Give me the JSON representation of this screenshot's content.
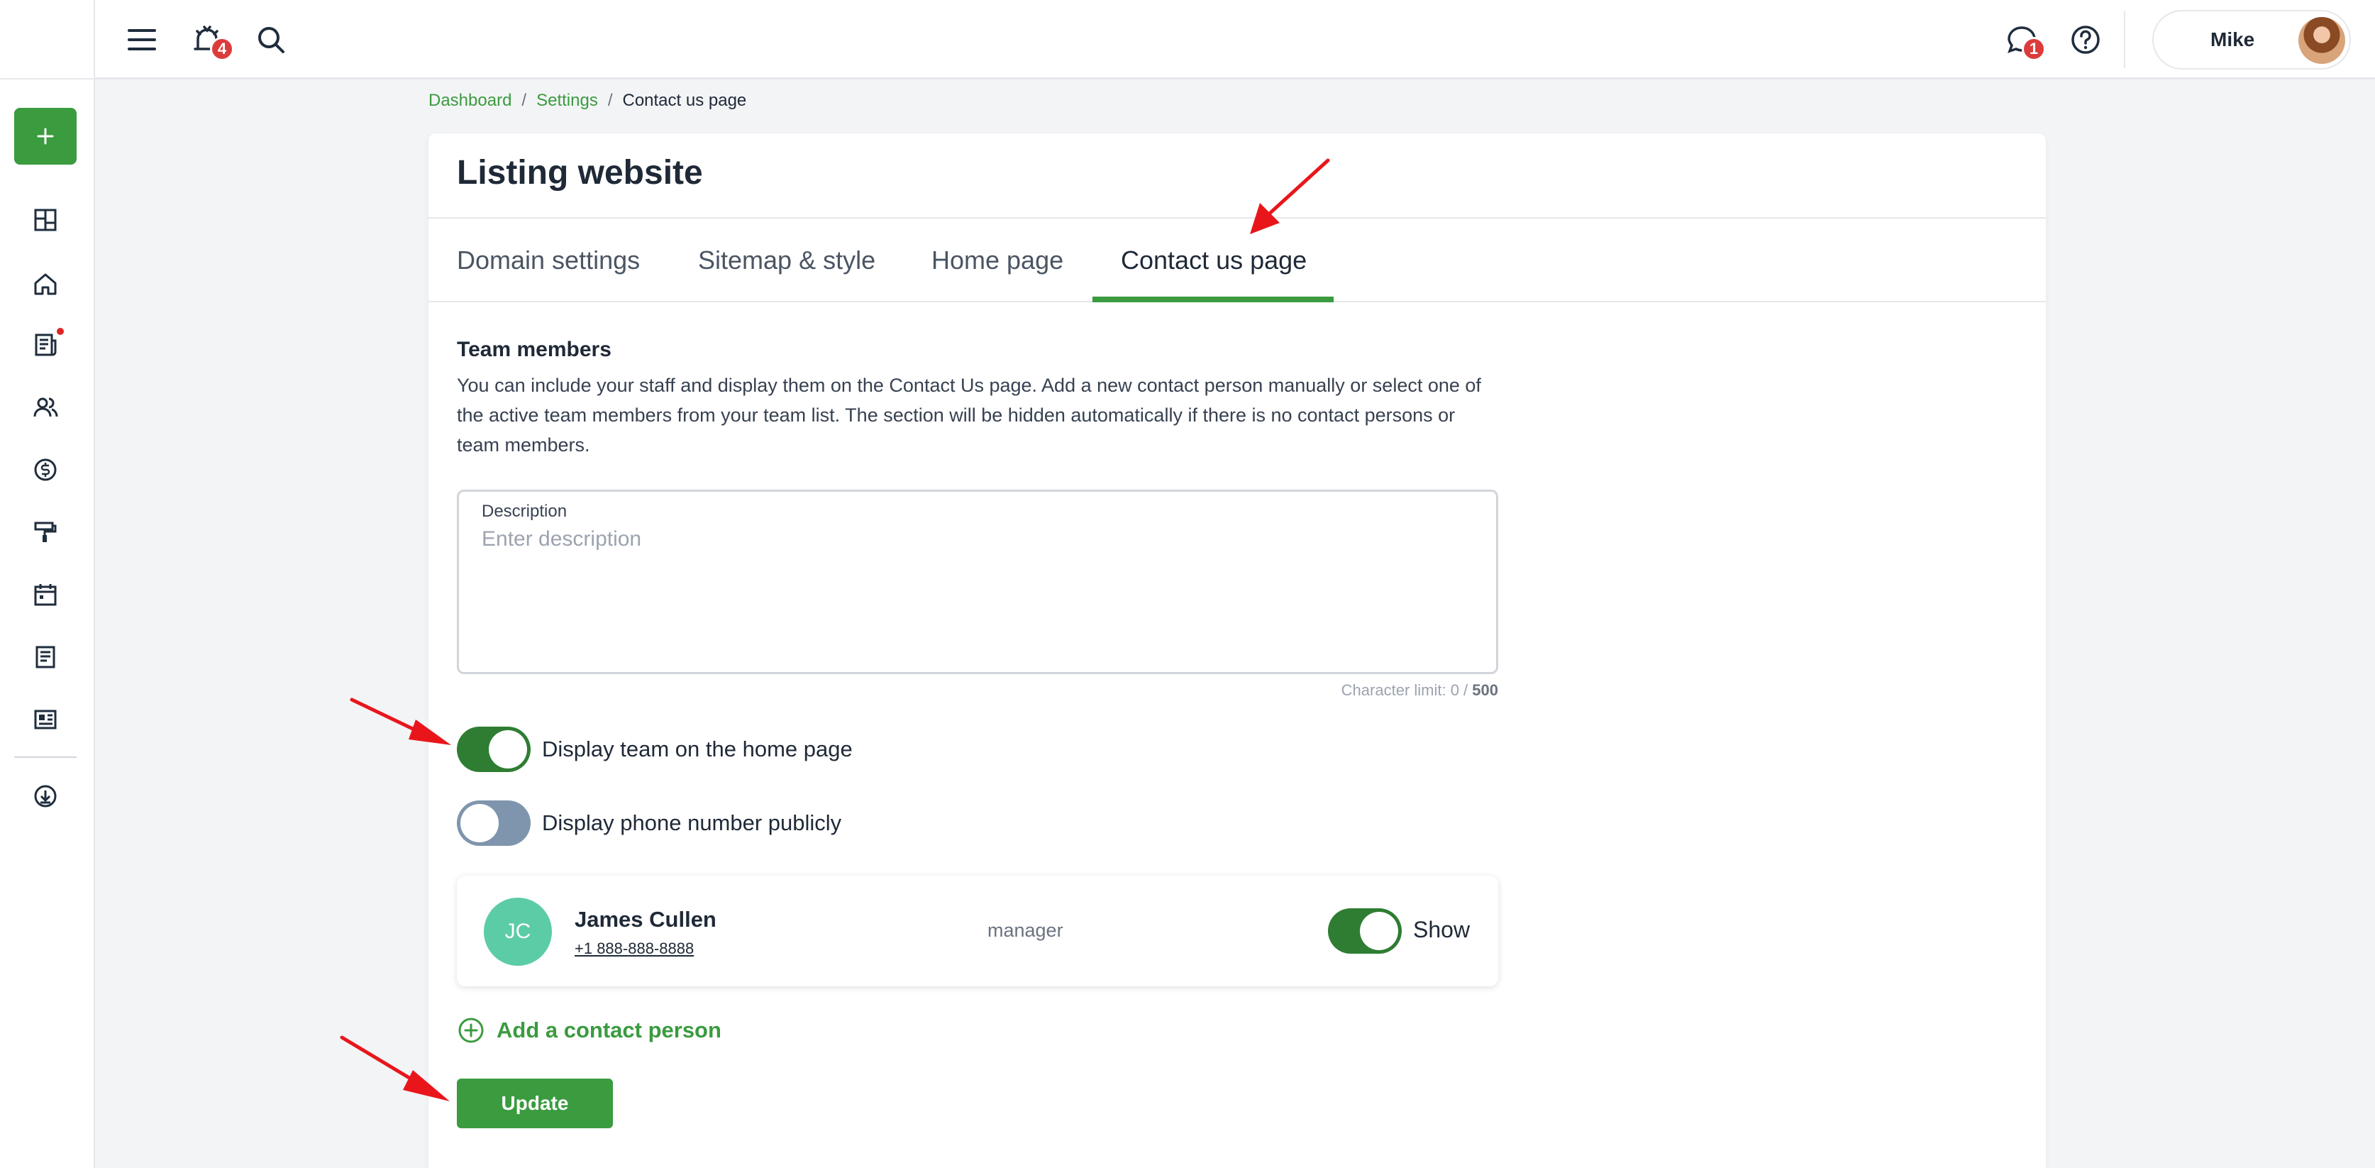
{
  "topbar": {
    "notifications_badge": "4",
    "messages_badge": "1",
    "user_name": "Mike"
  },
  "breadcrumb": {
    "items": [
      "Dashboard",
      "Settings"
    ],
    "separator": "/",
    "current": "Contact us page"
  },
  "page": {
    "title": "Listing website",
    "tabs": [
      {
        "label": "Domain settings"
      },
      {
        "label": "Sitemap & style"
      },
      {
        "label": "Home page"
      },
      {
        "label": "Contact us page"
      }
    ],
    "active_tab": "Contact us page"
  },
  "team_section": {
    "title": "Team members",
    "description": "You can include your staff and display them on the Contact Us page. Add a new contact person manually or select one of the active team members from your team list. The section will be hidden automatically if there is no contact persons or team members.",
    "description_field": {
      "label": "Description",
      "placeholder": "Enter description",
      "value": ""
    },
    "char_limit_text": "Character limit: 0 / ",
    "char_limit_max": "500",
    "toggles": [
      {
        "label": "Display team on the home page",
        "on": true
      },
      {
        "label": "Display phone number publicly",
        "on": false
      }
    ],
    "members": [
      {
        "initials": "JC",
        "name": "James Cullen",
        "phone": "+1 888-888-8888",
        "role": "manager",
        "show_label": "Show",
        "show_on": true
      }
    ],
    "add_contact_label": "Add a contact person",
    "update_label": "Update"
  },
  "colors": {
    "brand_green": "#3a9b3f",
    "toggle_on": "#2e7d32",
    "toggle_off": "#7f95ad",
    "badge_red": "#dc3b3b",
    "annotation_arrow": "#e8161b"
  }
}
